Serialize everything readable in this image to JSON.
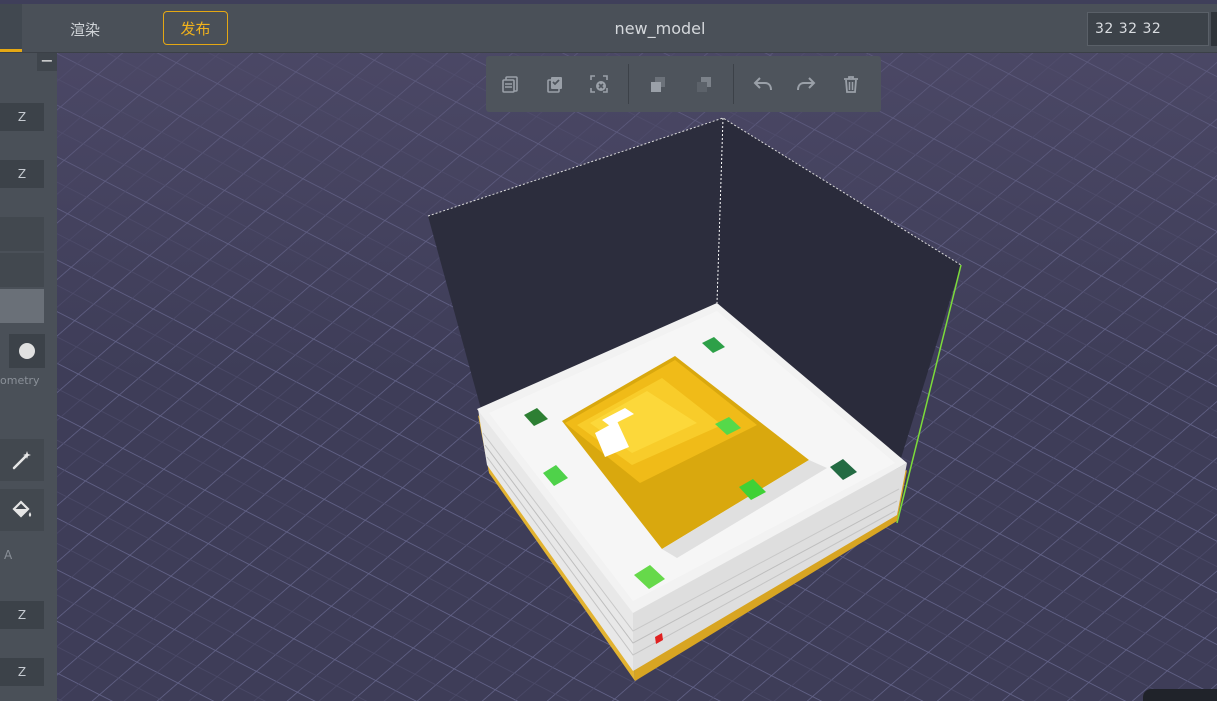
{
  "topbar": {
    "render_tab": "渲染",
    "publish_button": "发布",
    "model_title": "new_model",
    "dimensions": "32  32  32"
  },
  "left_panel": {
    "collapse_symbol": "−",
    "axis_labels": [
      "Z",
      "Z",
      "Z",
      "Z"
    ],
    "section_label": "ometry",
    "section_letter": "A"
  },
  "toolbar": {
    "buttons": [
      "copy-icon",
      "select-all-icon",
      "deselect-icon",
      "front-layer-icon",
      "back-layer-icon",
      "undo-icon",
      "redo-icon",
      "trash-icon"
    ]
  },
  "colors": {
    "accent": "#e5a814",
    "background": "#3f3f5a",
    "panel": "#4a5058"
  }
}
